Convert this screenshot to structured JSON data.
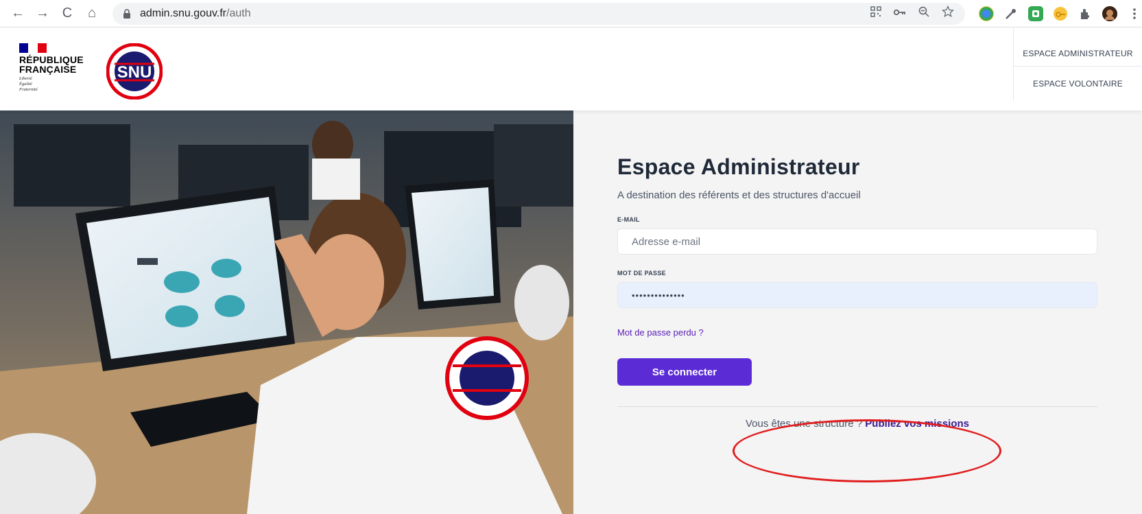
{
  "browser": {
    "url_host": "admin.snu.gouv.fr",
    "url_path": "/auth",
    "nav_back": "←",
    "nav_forward": "→",
    "nav_reload": "C",
    "nav_home": "⌂"
  },
  "header": {
    "republic_line1": "RÉPUBLIQUE",
    "republic_line2": "FRANÇAISE",
    "motto_1": "Liberté",
    "motto_2": "Égalité",
    "motto_3": "Fraternité",
    "snu_logo_text": "SNU",
    "nav": {
      "admin": "ESPACE ADMINISTRATEUR",
      "volunteer": "ESPACE VOLONTAIRE"
    }
  },
  "form": {
    "title": "Espace Administrateur",
    "subtitle": "A destination des référents et des structures d'accueil",
    "email_label": "E-MAIL",
    "email_placeholder": "Adresse e-mail",
    "email_value": "",
    "password_label": "MOT DE PASSE",
    "password_value": "••••••••••••••",
    "forgot_link": "Mot de passe perdu ?",
    "submit_label": "Se connecter",
    "structure_text": "Vous êtes une structure ? ",
    "structure_link": "Publiez vos missions"
  },
  "colors": {
    "primary": "#5b2bd6",
    "link": "#5b21b6",
    "annotation": "#e11d1d",
    "form_bg": "#f4f4f5"
  },
  "icons": [
    "back-arrow-icon",
    "forward-arrow-icon",
    "reload-icon",
    "home-icon",
    "lock-icon",
    "qr-icon",
    "key-icon",
    "zoom-icon",
    "star-icon",
    "extension-icon",
    "profile-avatar",
    "kebab-menu-icon"
  ]
}
